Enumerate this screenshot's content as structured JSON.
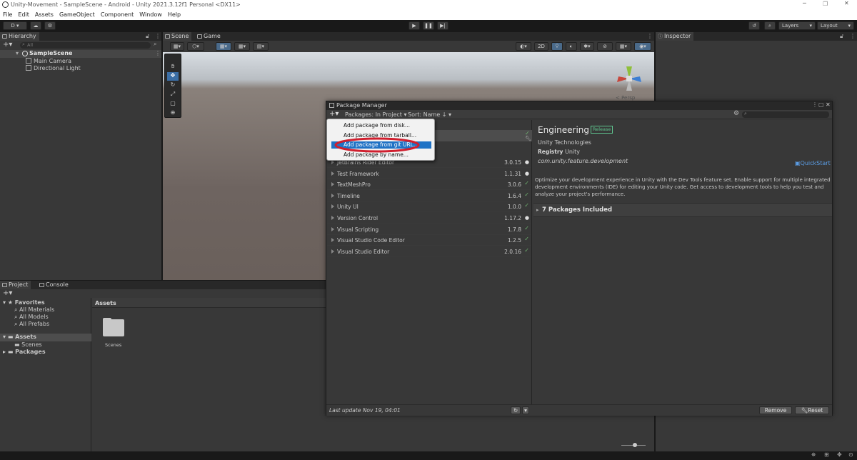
{
  "window": {
    "title": "Unity-Movement - SampleScene - Android - Unity 2021.3.12f1 Personal <DX11>"
  },
  "menu": [
    "File",
    "Edit",
    "Assets",
    "GameObject",
    "Component",
    "Window",
    "Help"
  ],
  "toolbar": {
    "account": "D",
    "layers": "Layers",
    "layout": "Layout"
  },
  "hierarchy": {
    "tab": "Hierarchy",
    "search_placeholder": "All",
    "scene": "SampleScene",
    "items": [
      "Main Camera",
      "Directional Light"
    ]
  },
  "scene_view": {
    "tabs": [
      "Scene",
      "Game"
    ],
    "mode_2d": "2D",
    "persp": "< Persp"
  },
  "inspector": {
    "tab": "Inspector"
  },
  "project": {
    "tabs": [
      "Project",
      "Console"
    ],
    "favorites": {
      "label": "Favorites",
      "items": [
        "All Materials",
        "All Models",
        "All Prefabs"
      ]
    },
    "assets": {
      "label": "Assets",
      "items": [
        "Scenes"
      ]
    },
    "packages": {
      "label": "Packages"
    },
    "breadcrumb": "Assets",
    "folder": "Scenes"
  },
  "package_manager": {
    "title": "Package Manager",
    "filter": "Packages: In Project",
    "sort": "Sort: Name",
    "add_menu": [
      "Add package from disk...",
      "Add package from tarball...",
      "Add package from git URL...",
      "Add package by name..."
    ],
    "selected_menu_index": 2,
    "packages": [
      {
        "name": "JetBrains Rider Editor",
        "version": "3.0.15",
        "status": "info"
      },
      {
        "name": "Test Framework",
        "version": "1.1.31",
        "status": "info"
      },
      {
        "name": "TextMeshPro",
        "version": "3.0.6",
        "status": "check"
      },
      {
        "name": "Timeline",
        "version": "1.6.4",
        "status": "check"
      },
      {
        "name": "Unity UI",
        "version": "1.0.0",
        "status": "check"
      },
      {
        "name": "Version Control",
        "version": "1.17.2",
        "status": "info"
      },
      {
        "name": "Visual Scripting",
        "version": "1.7.8",
        "status": "check"
      },
      {
        "name": "Visual Studio Code Editor",
        "version": "1.2.5",
        "status": "check"
      },
      {
        "name": "Visual Studio Editor",
        "version": "2.0.16",
        "status": "check"
      }
    ],
    "last_update": "Last update Nov 19, 04:01",
    "detail": {
      "name": "Engineering",
      "badge": "Release",
      "author": "Unity Technologies",
      "registry_label": "Registry",
      "registry_value": "Unity",
      "id": "com.unity.feature.development",
      "quickstart": "QuickStart",
      "description": "Optimize your development experience in Unity with the Dev Tools feature set. Enable support for multiple integrated development environments (IDE) for editing your Unity code. Get access to development tools to help you test and analyze your project's performance.",
      "included": "7 Packages Included"
    },
    "buttons": {
      "remove": "Remove",
      "reset": "Reset"
    }
  },
  "colors": {
    "accent": "#2c5d87",
    "selection": "#1f72c5",
    "annotation": "#d01f2e",
    "release": "#5ec48e"
  }
}
